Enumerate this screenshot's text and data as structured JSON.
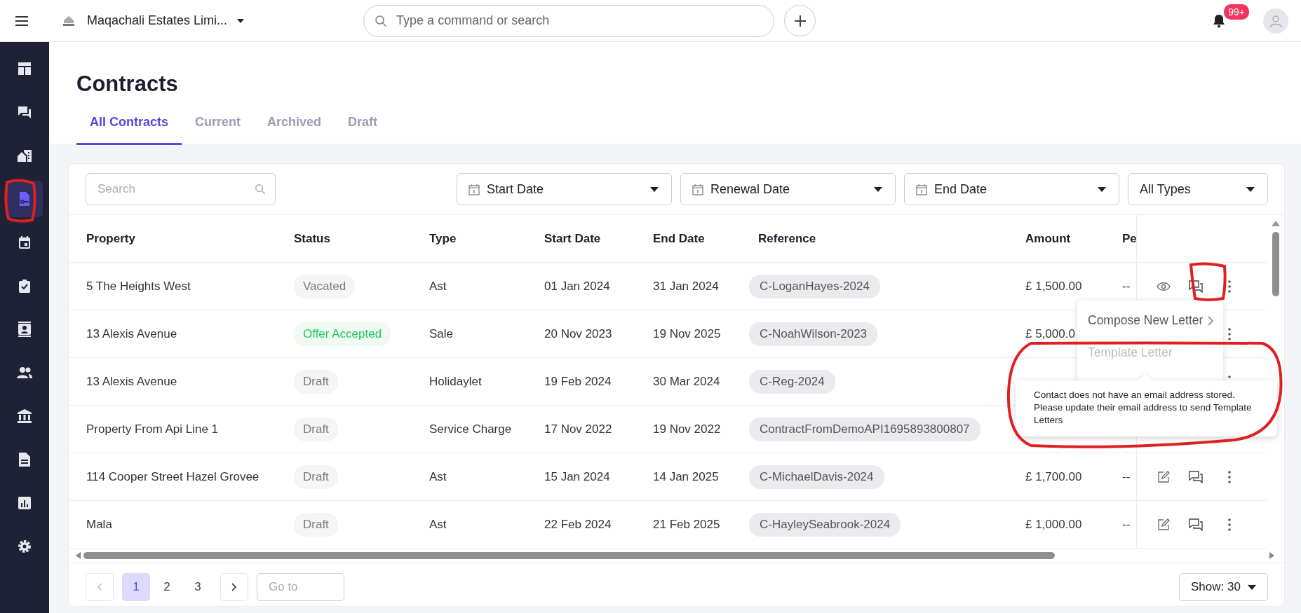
{
  "topbar": {
    "org_name": "Maqachali Estates Limi...",
    "search": {
      "placeholder": "Type a command or search"
    },
    "notification_badge": "99+"
  },
  "sidebar": {
    "items": [
      {
        "selected": false
      },
      {
        "selected": false
      },
      {
        "selected": false
      },
      {
        "selected": true
      },
      {
        "selected": false
      },
      {
        "selected": false
      },
      {
        "selected": false
      },
      {
        "selected": false
      },
      {
        "selected": false
      },
      {
        "selected": false
      },
      {
        "selected": false
      },
      {
        "selected": false
      }
    ]
  },
  "page": {
    "title": "Contracts",
    "tabs": [
      {
        "label": "All Contracts",
        "selected": true
      },
      {
        "label": "Current",
        "selected": false
      },
      {
        "label": "Archived",
        "selected": false
      },
      {
        "label": "Draft",
        "selected": false
      }
    ]
  },
  "filters": {
    "search": {
      "placeholder": "Search"
    },
    "dropdowns": [
      {
        "label": "Start Date",
        "kind": "date"
      },
      {
        "label": "Renewal Date",
        "kind": "date"
      },
      {
        "label": "End Date",
        "kind": "date"
      },
      {
        "label": "All Types",
        "kind": "plain"
      }
    ]
  },
  "table": {
    "columns": [
      "Property",
      "Status",
      "Type",
      "Start Date",
      "End Date",
      "Reference",
      "Amount",
      "Pe"
    ],
    "rows": [
      {
        "property": "5 The Heights West",
        "status": {
          "text": "Vacated",
          "color": "#7a7a80"
        },
        "type": "Ast",
        "start": "01 Jan 2024",
        "end": "31 Jan 2024",
        "reference": "C-LoganHayes-2024",
        "amount": "£ 1,500.00",
        "per": "--",
        "actions": [
          {
            "kind": "view"
          },
          {
            "kind": "letter"
          },
          {
            "kind": "more"
          }
        ]
      },
      {
        "property": "13 Alexis Avenue",
        "status": {
          "text": "Offer Accepted",
          "color": "#22c55e"
        },
        "type": "Sale",
        "start": "20 Nov 2023",
        "end": "19 Nov 2025",
        "reference": "C-NoahWilson-2023",
        "amount": "£ 5,000.0",
        "actions": [
          {
            "kind": "more"
          }
        ]
      },
      {
        "property": "13 Alexis Avenue",
        "status": {
          "text": "Draft",
          "color": "#7a7a80"
        },
        "type": "Holidaylet",
        "start": "19 Feb 2024",
        "end": "30 Mar 2024",
        "reference": "C-Reg-2024",
        "actions": [
          {
            "kind": "more"
          }
        ]
      },
      {
        "property": "Property From Api Line 1",
        "status": {
          "text": "Draft",
          "color": "#7a7a80"
        },
        "type": "Service Charge",
        "start": "17 Nov 2022",
        "end": "19 Nov 2022",
        "reference": "ContractFromDemoAPI1695893800807",
        "actions": []
      },
      {
        "property": "114 Cooper Street Hazel Grovee",
        "status": {
          "text": "Draft",
          "color": "#7a7a80"
        },
        "type": "Ast",
        "start": "15 Jan 2024",
        "end": "14 Jan 2025",
        "reference": "C-MichaelDavis-2024",
        "amount": "£ 1,700.00",
        "per": "--",
        "actions": [
          {
            "kind": "edit"
          },
          {
            "kind": "letter"
          },
          {
            "kind": "more"
          }
        ]
      },
      {
        "property": "Mala",
        "status": {
          "text": "Draft",
          "color": "#7a7a80"
        },
        "type": "Ast",
        "start": "22 Feb 2024",
        "end": "21 Feb 2025",
        "reference": "C-HayleySeabrook-2024",
        "amount": "£ 1,000.00",
        "per": "--",
        "actions": [
          {
            "kind": "edit"
          },
          {
            "kind": "letter"
          },
          {
            "kind": "more"
          }
        ]
      }
    ]
  },
  "letter_menu": {
    "items": [
      {
        "label": "Compose New Letter",
        "disabled": false,
        "submenu": true
      },
      {
        "label": "Template Letter",
        "disabled": true,
        "submenu": false
      }
    ]
  },
  "tooltip": {
    "text": "Contact does not have an email address stored. Please update their email address to send Template Letters"
  },
  "pagination": {
    "pages": [
      {
        "label": "1",
        "selected": true
      },
      {
        "label": "2",
        "selected": false
      },
      {
        "label": "3",
        "selected": false
      }
    ],
    "goto": {
      "placeholder": "Go to"
    },
    "page_size": "Show: 30"
  }
}
